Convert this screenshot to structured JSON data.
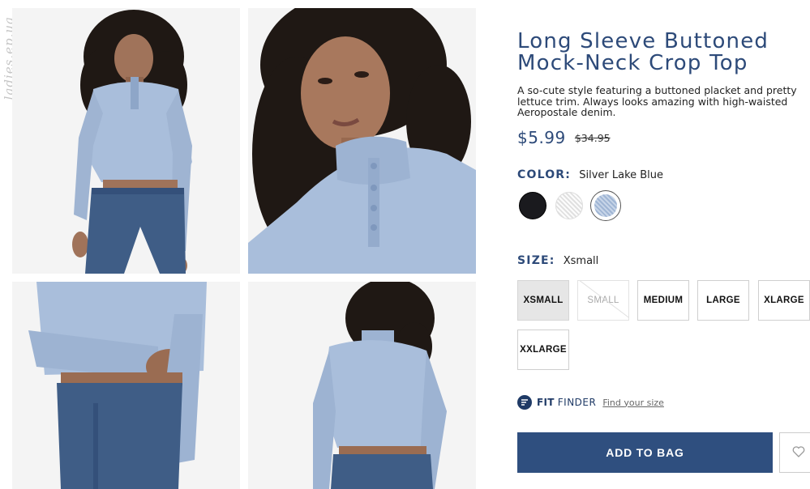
{
  "watermark": "ladies.ep.ua",
  "gallery": {
    "images": [
      {
        "alt": "model front view"
      },
      {
        "alt": "model close-up"
      },
      {
        "alt": "sleeve detail"
      },
      {
        "alt": "model back view"
      }
    ]
  },
  "product": {
    "title": "Long Sleeve Buttoned Mock-Neck Crop Top",
    "description": "A so-cute style featuring a buttoned placket and pretty lettuce trim. Always looks amazing with high-waisted Aeropostale denim.",
    "price_sale": "$5.99",
    "price_original": "$34.95"
  },
  "color": {
    "label": "COLOR:",
    "selected": "Silver Lake Blue",
    "swatches": [
      {
        "name": "black",
        "hex": "#1a1a1e"
      },
      {
        "name": "white",
        "hex": "#efefef"
      },
      {
        "name": "silver lake blue",
        "hex": "#a9bedb",
        "selected": true
      }
    ]
  },
  "size": {
    "label": "SIZE:",
    "selected": "Xsmall",
    "options": [
      {
        "label": "XSMALL",
        "state": "selected"
      },
      {
        "label": "SMALL",
        "state": "unavailable"
      },
      {
        "label": "MEDIUM",
        "state": "available"
      },
      {
        "label": "LARGE",
        "state": "available"
      },
      {
        "label": "XLARGE",
        "state": "available"
      },
      {
        "label": "XXLARGE",
        "state": "available"
      }
    ]
  },
  "fit_finder": {
    "brand_bold": "FIT",
    "brand_rest": "FINDER",
    "link": "Find your size"
  },
  "actions": {
    "add_to_bag": "ADD TO BAG"
  },
  "colors": {
    "accent": "#2d4a79",
    "button": "#2f4f7f",
    "shirt": "#a9bedb",
    "denim": "#3f5d86"
  }
}
